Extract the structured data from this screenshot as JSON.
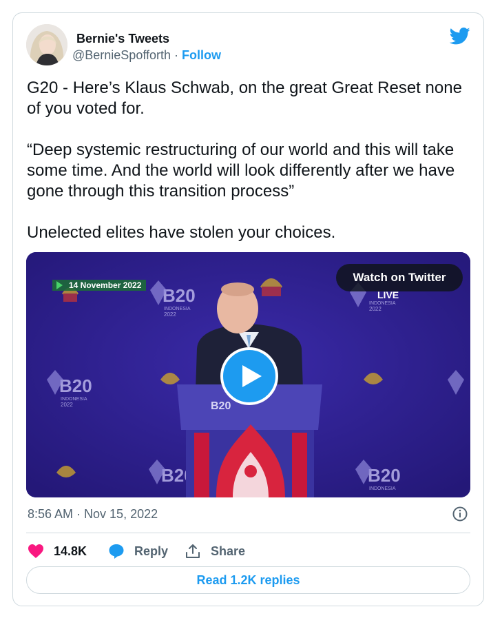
{
  "author": {
    "display_name": "Bernie's Tweets",
    "handle": "@BernieSpofforth",
    "separator": " · ",
    "follow_label": "Follow"
  },
  "tweet": {
    "paragraphs": [
      "G20 - Here’s Klaus Schwab, on the great Great Reset none of you voted for.",
      "“Deep systemic restructuring of our world and this will take some time. And the world will look differently after we have gone through this transition process”",
      "Unelected elites have stolen your choices."
    ]
  },
  "video": {
    "watch_label": "Watch on Twitter",
    "date_badge": "14 November 2022",
    "live_badge": "LIVE",
    "backdrop_logo": "B20",
    "backdrop_sub": "INDONESIA",
    "backdrop_year": "2022"
  },
  "meta": {
    "timestamp": "8:56 AM · Nov 15, 2022"
  },
  "actions": {
    "likes": "14.8K",
    "reply_label": "Reply",
    "share_label": "Share"
  },
  "read_replies_label": "Read 1.2K replies",
  "colors": {
    "accent": "#1d9bf0",
    "like": "#f91880",
    "muted": "#536471",
    "border": "#cfd9de",
    "video_bg": "#2b1e8c"
  },
  "icons": [
    "twitter-bird-icon",
    "play-icon",
    "info-icon",
    "heart-icon",
    "reply-bubble-icon",
    "share-icon"
  ]
}
